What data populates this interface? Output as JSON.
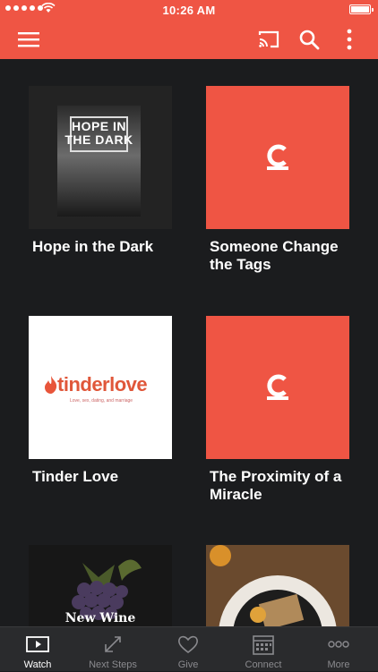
{
  "status_bar": {
    "time": "10:26 AM"
  },
  "colors": {
    "accent": "#ef5544",
    "background": "#1b1c1e",
    "tab_inactive": "#8a8a8e",
    "tab_active": "#ffffff"
  },
  "toolbar": {
    "icons": [
      "menu-icon",
      "cast-icon",
      "search-icon",
      "more-vertical-icon"
    ]
  },
  "cards": [
    {
      "title": "Hope in the Dark",
      "thumb_text": "HOPE IN THE DARK",
      "icon": "hope-in-the-dark-artwork"
    },
    {
      "title": "Someone Change the Tags",
      "icon": "church-c-logo-icon"
    },
    {
      "title": "Tinder Love",
      "thumb_text": "tinderlove",
      "thumb_sub": "Love, sex, dating, and marriage",
      "icon": "tinderlove-artwork"
    },
    {
      "title": "The Proximity of a Miracle",
      "icon": "church-c-logo-icon"
    },
    {
      "title": "",
      "thumb_text": "New Wine",
      "icon": "grapes-artwork"
    },
    {
      "title": "",
      "icon": "dinner-plate-artwork"
    }
  ],
  "tabs": [
    {
      "label": "Watch",
      "icon": "play-icon",
      "active": true
    },
    {
      "label": "Next Steps",
      "icon": "arrows-icon",
      "active": false
    },
    {
      "label": "Give",
      "icon": "heart-icon",
      "active": false
    },
    {
      "label": "Connect",
      "icon": "calendar-icon",
      "active": false
    },
    {
      "label": "More",
      "icon": "ellipsis-icon",
      "active": false
    }
  ]
}
